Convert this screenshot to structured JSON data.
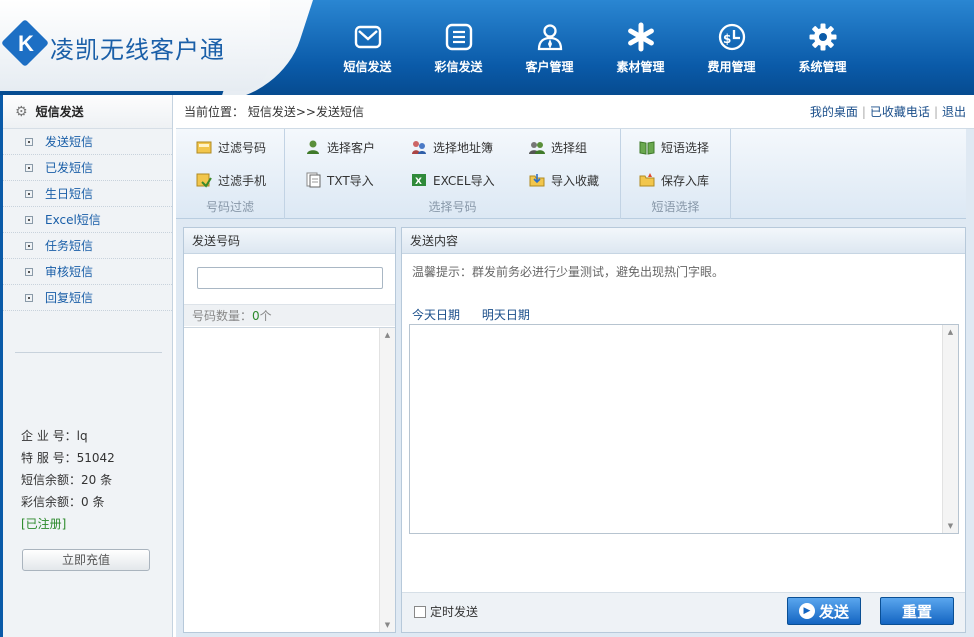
{
  "app": {
    "logo_letter": "K",
    "title": "凌凯无线客户通"
  },
  "nav": [
    {
      "label": "短信发送",
      "icon": "envelope-icon"
    },
    {
      "label": "彩信发送",
      "icon": "list-icon"
    },
    {
      "label": "客户管理",
      "icon": "person-icon"
    },
    {
      "label": "素材管理",
      "icon": "asterisk-icon"
    },
    {
      "label": "费用管理",
      "icon": "dollar-clock-icon"
    },
    {
      "label": "系统管理",
      "icon": "gear-icon"
    }
  ],
  "sidebar": {
    "header": "短信发送",
    "items": [
      {
        "label": "发送短信"
      },
      {
        "label": "已发短信"
      },
      {
        "label": "生日短信"
      },
      {
        "label": "Excel短信"
      },
      {
        "label": "任务短信"
      },
      {
        "label": "审核短信"
      },
      {
        "label": "回复短信"
      }
    ],
    "info": {
      "enterprise": "企 业 号：lq",
      "service": "特 服 号：51042",
      "sms_balance": "短信余额：20 条",
      "mms_balance": "彩信余额：0 条",
      "status": "[已注册]"
    },
    "recharge_label": "立即充值"
  },
  "breadcrumb": {
    "label": "当前位置：",
    "path": "短信发送>>发送短信"
  },
  "top_links": [
    "我的桌面",
    "已收藏电话",
    "退出"
  ],
  "toolbar": {
    "groups": [
      {
        "caption": "号码过滤",
        "buttons": [
          "过滤号码",
          "过滤手机"
        ]
      },
      {
        "caption": "选择号码",
        "buttons": [
          "选择客户",
          "选择地址簿",
          "选择组",
          "TXT导入",
          "EXCEL导入",
          "导入收藏"
        ]
      },
      {
        "caption": "短语选择",
        "buttons": [
          "短语选择",
          "保存入库"
        ]
      }
    ]
  },
  "numbers_panel": {
    "title": "发送号码",
    "count_label": "号码数量：",
    "count_value": "0",
    "count_unit": "个"
  },
  "content_panel": {
    "title": "发送内容",
    "hint": "温馨提示：群发前务必进行少量测试，避免出现热门字眼。",
    "date_links": [
      "今天日期",
      "明天日期"
    ],
    "timed_label": "定时发送",
    "send_label": "发送",
    "reset_label": "重置"
  },
  "colors": {
    "header_blue": "#0a5aa8",
    "link_blue": "#1a5fa8",
    "button_blue": "#1465c2",
    "success_green": "#2b8a2b"
  }
}
